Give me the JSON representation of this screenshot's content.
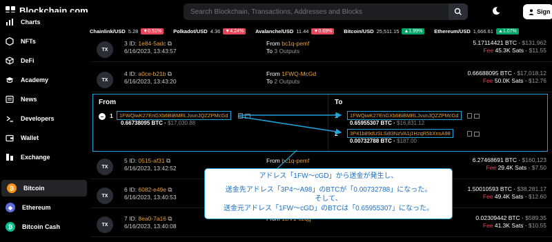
{
  "header": {
    "logo_text": "Blockchain.com",
    "search_placeholder": "Search Blockchain, Transactions, Addresses and Blocks",
    "signin_label": "Sign"
  },
  "ticker": [
    {
      "name": "Chainlink/USD",
      "price": "5.28",
      "change": "0.51%",
      "dir": "down"
    },
    {
      "name": "Polkadot/USD",
      "price": "4.36",
      "change": "4.24%",
      "dir": "down"
    },
    {
      "name": "Avalanche/USD",
      "price": "11.44",
      "change": "0.69%",
      "dir": "down"
    },
    {
      "name": "Bitcoin/USD",
      "price": "25,511.15",
      "change": "1.99%",
      "dir": "up"
    },
    {
      "name": "Ethereum/USD",
      "price": "1,666.61",
      "change": "1.07%",
      "dir": "up"
    }
  ],
  "sidebar": {
    "items": [
      {
        "label": "Charts"
      },
      {
        "label": "NFTs"
      },
      {
        "label": "DeFi"
      },
      {
        "label": "Academy"
      },
      {
        "label": "News"
      },
      {
        "label": "Developers"
      },
      {
        "label": "Wallet"
      },
      {
        "label": "Exchange"
      },
      {
        "label": "Bitcoin"
      },
      {
        "label": "Ethereum"
      },
      {
        "label": "Bitcoin Cash"
      }
    ]
  },
  "transactions": [
    {
      "badge": "TX",
      "index": "3",
      "id_label": "ID:",
      "hash": "1e84-5adc",
      "date": "6/16/2023, 13:43:57",
      "from_label": "From",
      "from": "bc1q-pemf",
      "to_label": "To",
      "to": "3 Outputs",
      "amount": "5.17114421 BTC",
      "amount_usd": "$131,962",
      "fee_label": "Fee",
      "fee": "45.3K Sats",
      "fee_usd": "$11.55"
    },
    {
      "badge": "TX",
      "index": "4",
      "id_label": "ID:",
      "hash": "a0ce-b21b",
      "date": "6/16/2023, 13:43:20",
      "from_label": "From",
      "from": "1FWQ-McGd",
      "to_label": "To",
      "to": "2 Outputs",
      "amount": "0.66688095 BTC",
      "amount_usd": "$17,018.12",
      "fee_label": "Fee",
      "fee": "50.0K Sats",
      "fee_usd": "$12.76"
    },
    {
      "badge": "TX",
      "index": "5",
      "id_label": "ID:",
      "hash": "0515-af31",
      "date": "6/16/2023, 13:42:52",
      "from_label": "From",
      "from": "bc1q-pemf",
      "to_label": "To",
      "to": "",
      "amount": "6.27468691 BTC",
      "amount_usd": "$160,123",
      "fee_label": "Fee",
      "fee": "29.4K Sats",
      "fee_usd": "$7.50"
    },
    {
      "badge": "TX",
      "index": "6",
      "id_label": "ID:",
      "hash": "6082-e49e",
      "date": "6/16/2023, 13:40:53",
      "from_label": "",
      "from": "",
      "to_label": "",
      "to": "",
      "amount": "1.50010593 BTC",
      "amount_usd": "$38,281.17",
      "fee_label": "Fee",
      "fee": "49.4K Sats",
      "fee_usd": "$12.60"
    },
    {
      "badge": "TX",
      "index": "7",
      "id_label": "ID:",
      "hash": "8ea0-7a16",
      "date": "6/16/2023, 13:40:08",
      "from_label": "From",
      "from": "1DV1-6zqg",
      "to_label": "",
      "to": "",
      "amount": "0.02309442 BTC",
      "amount_usd": "$589.35",
      "fee_label": "Fee",
      "fee": "41.3K Sats",
      "fee_usd": "$10.55"
    }
  ],
  "detail": {
    "from_header": "From",
    "to_header": "To",
    "input": {
      "index": "1",
      "address": "1FWQiwK27EnGXb6BiBMRLJvunJQZZPMcGd",
      "amount": "0.66738095 BTC",
      "usd": "$17,030.88"
    },
    "outputs": [
      {
        "index": "1",
        "address": "1FWQiwK27EnGXb6BiBMRLJvunJQZZPMcGd",
        "amount": "0.65955307 BTC",
        "usd": "$16,831.12"
      },
      {
        "index": "2",
        "address": "3P41b89dUSLSi83NzVA1j1HzqR5bXnsA98",
        "amount": "0.00732788 BTC",
        "usd": "$187.00"
      }
    ]
  },
  "callout": {
    "line1": "アドレス「1FW～cGD」から送金が発生し、",
    "line2": "送金先アドレス「3P4～A98」のBTCが「0.00732788」になった。",
    "line3": "そして、",
    "line4": "送金元アドレス「1FW～cGD」のBTCは「0.65955307」になった。"
  },
  "colors": {
    "accent": "#1ea3db",
    "hash": "#e9a23b",
    "down": "#e9445a",
    "up": "#00a46a",
    "callout_text": "#1a6fc4"
  }
}
